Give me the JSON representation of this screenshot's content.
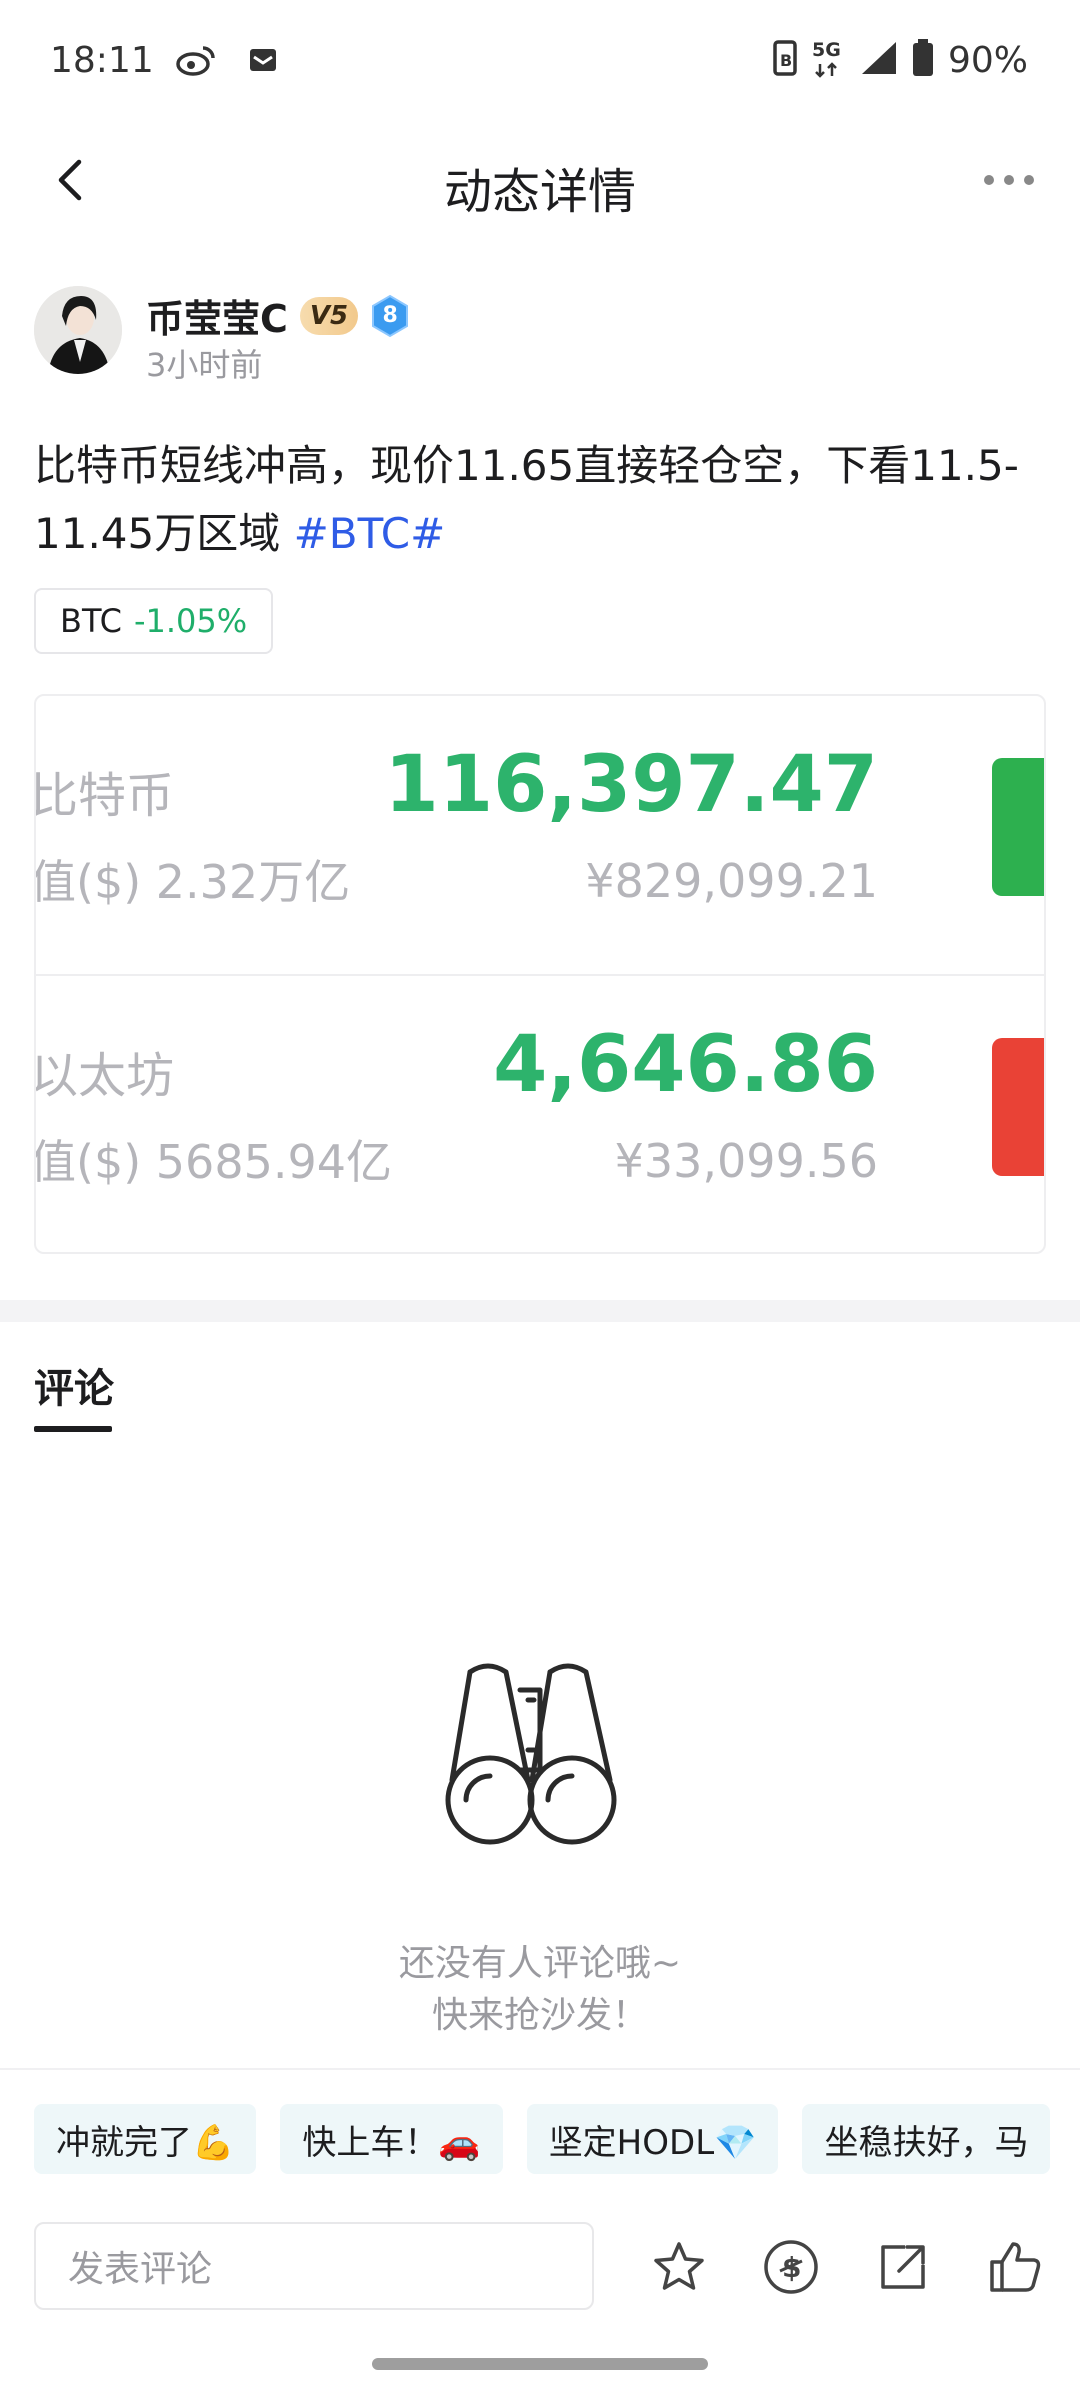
{
  "status_bar": {
    "time": "18:11",
    "network": "5G",
    "battery": "90%"
  },
  "header": {
    "title": "动态详情"
  },
  "author": {
    "name": "币莹莹C",
    "vip": "V5",
    "level": "8",
    "time_ago": "3小时前"
  },
  "post": {
    "text": "比特币短线冲高，现价11.65直接轻仓空，下看11.5-11.45万区域 ",
    "hashtag": "#BTC#",
    "ticker": {
      "symbol": "BTC",
      "change": "-1.05%"
    }
  },
  "market": [
    {
      "name": "比特币",
      "cap": "值($) 2.32万亿",
      "price": "116,397.47",
      "cny": "¥829,099.21",
      "chg_color": "#2db04f"
    },
    {
      "name": "以太坊",
      "cap": "值($) 5685.94亿",
      "price": "4,646.86",
      "cny": "¥33,099.56",
      "chg_color": "#e94236"
    }
  ],
  "comments": {
    "tab": "评论",
    "empty_line1": "还没有人评论哦~",
    "empty_line2": "快来抢沙发！"
  },
  "quick_replies": [
    "冲就完了💪",
    "快上车！🚗",
    "坚定HODL💎",
    "坐稳扶好，马"
  ],
  "input": {
    "placeholder": "发表评论"
  }
}
